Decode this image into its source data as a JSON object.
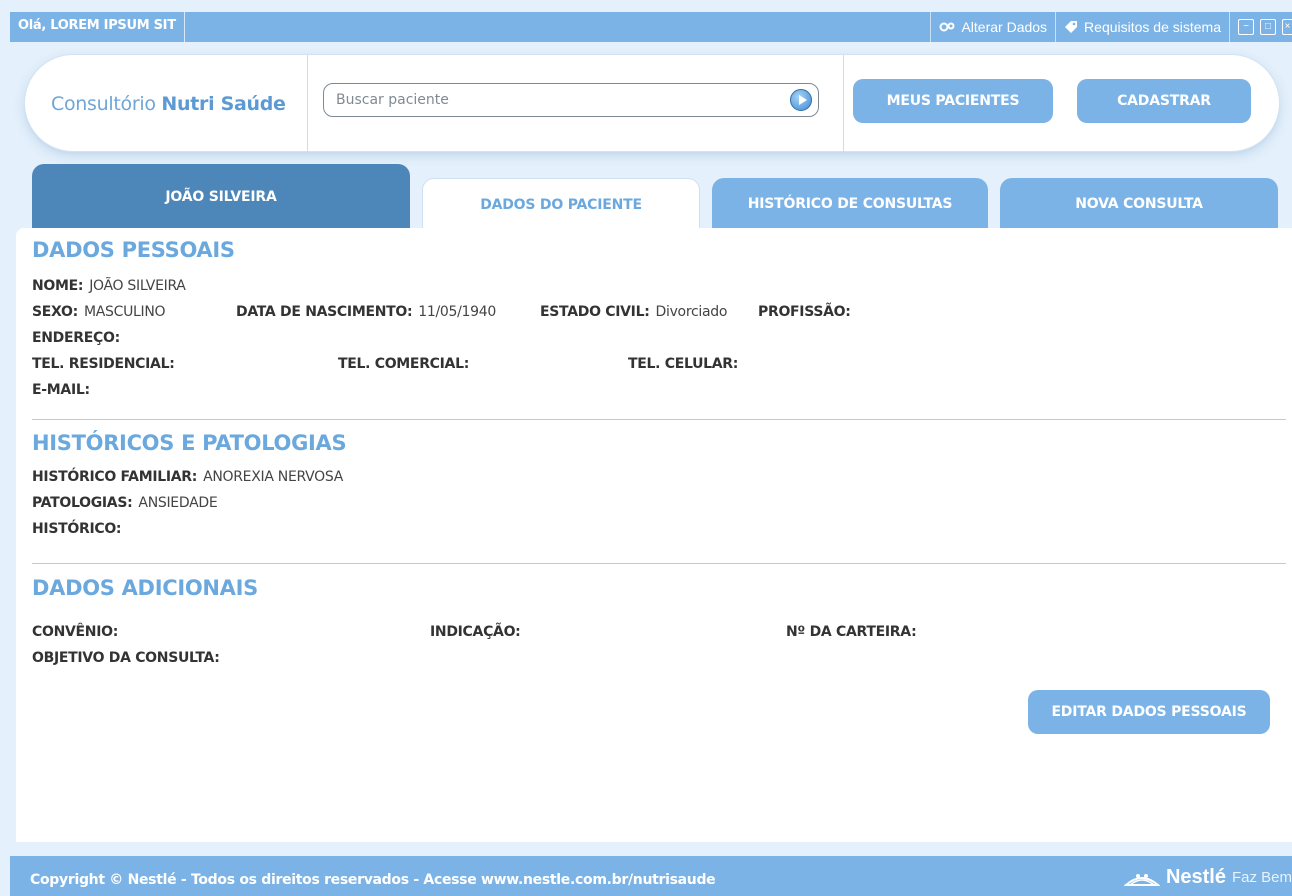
{
  "topbar": {
    "greeting": "Olá, LOREM IPSUM SIT",
    "alterar_dados": "Alterar Dados",
    "requisitos": "Requisitos de sistema"
  },
  "header": {
    "brand_prefix": "Consultório ",
    "brand_name": "Nutri Saúde",
    "search_placeholder": "Buscar paciente",
    "meus_pacientes": "MEUS PACIENTES",
    "cadastrar": "CADASTRAR"
  },
  "tabs": {
    "patient_name": "JOÃO SILVEIRA",
    "dados": "DADOS DO PACIENTE",
    "historico": "HISTÓRICO DE CONSULTAS",
    "nova": "NOVA CONSULTA"
  },
  "dados_pessoais": {
    "title": "DADOS PESSOAIS",
    "nome_label": "NOME:",
    "nome": "JOÃO SILVEIRA",
    "sexo_label": "SEXO:",
    "sexo": "MASCULINO",
    "nasc_label": "DATA DE NASCIMENTO:",
    "nasc": "11/05/1940",
    "civil_label": "ESTADO CIVIL:",
    "civil": "Divorciado",
    "profissao_label": "PROFISSÃO:",
    "endereco_label": "ENDEREÇO:",
    "tel_res_label": "TEL. RESIDENCIAL:",
    "tel_com_label": "TEL. COMERCIAL:",
    "tel_cel_label": "TEL. CELULAR:",
    "email_label": "E-MAIL:"
  },
  "historicos": {
    "title": "HISTÓRICOS E PATOLOGIAS",
    "familiar_label": "HISTÓRICO FAMILIAR:",
    "familiar": "ANOREXIA NERVOSA",
    "patologias_label": "PATOLOGIAS:",
    "patologias": "ANSIEDADE",
    "historico_label": "HISTÓRICO:"
  },
  "adicionais": {
    "title": "DADOS ADICIONAIS",
    "convenio_label": "CONVÊNIO:",
    "indicacao_label": "INDICAÇÃO:",
    "carteira_label": "Nº DA CARTEIRA:",
    "objetivo_label": "OBJETIVO DA CONSULTA:"
  },
  "edit_button": "EDITAR DADOS PESSOAIS",
  "footer": {
    "copyright": "Copyright © Nestlé - Todos os direitos reservados - ",
    "acesse": "Acesse www.nestle.com.br/nutrisaude",
    "brand": "Nestlé",
    "slogan": "Faz Bem"
  },
  "colors": {
    "accent": "#7cb3e6",
    "dark_tab": "#4d86b8",
    "section_title": "#6aa8de"
  }
}
